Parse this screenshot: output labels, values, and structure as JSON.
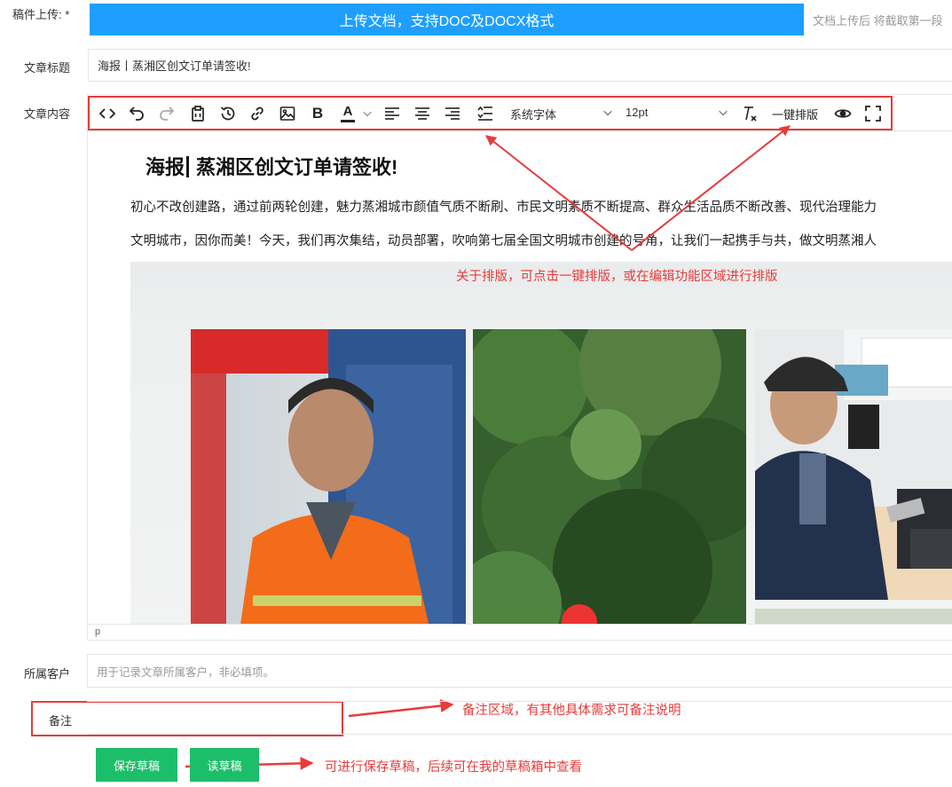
{
  "upload": {
    "label": "稿件上传:",
    "required_mark": "*",
    "button": "上传文档，支持DOC及DOCX格式",
    "tip": "文档上传后 将截取第一段"
  },
  "title_field": {
    "label": "文章标题",
    "value": "海报丨蒸湘区创文订单请签收!"
  },
  "content_field": {
    "label": "文章内容"
  },
  "toolbar": {
    "icons": [
      "code-icon",
      "undo-icon",
      "redo-icon",
      "paste-icon",
      "history-icon",
      "link-icon",
      "image-icon",
      "bold-icon",
      "font-color-icon",
      "align-left-icon",
      "align-center-icon",
      "align-right-icon",
      "line-height-icon",
      "clear-format-icon",
      "preview-icon",
      "fullscreen-icon"
    ],
    "font_family": "系统字体",
    "font_size": "12pt",
    "one_click_layout": "一键排版",
    "bold_glyph": "B",
    "font_color_glyph": "A"
  },
  "document": {
    "title_part1": "海报",
    "title_part2": "蒸湘区创文订单请签收!",
    "para1": "初心不改创建路，通过前两轮创建，魅力蒸湘城市颜值气质不断刷、市民文明素质不断提高、群众生活品质不断改善、现代治理能力",
    "para2": "文明城市，因你而美！今天，我们再次集结，动员部署，吹响第七届全国文明城市创建的号角，让我们一起携手与共，做文明蒸湘人",
    "status_path": "p"
  },
  "annotations": {
    "layout_note": "关于排版，可点击一键排版，或在编辑功能区域进行排版",
    "remark_note": "备注区域，有其他具体需求可备注说明",
    "draft_note": "可进行保存草稿，后续可在我的草稿箱中查看"
  },
  "client_field": {
    "label": "所属客户",
    "placeholder": "用于记录文章所属客户，非必填项。"
  },
  "remark_field": {
    "label": "备注",
    "value": ""
  },
  "buttons": {
    "save_draft": "保存草稿",
    "read_draft": "读草稿"
  },
  "colors": {
    "primary_blue": "#1e9fff",
    "green": "#1dbe6a",
    "annotation_red": "#e83b3b",
    "border": "#e6e6e6"
  }
}
